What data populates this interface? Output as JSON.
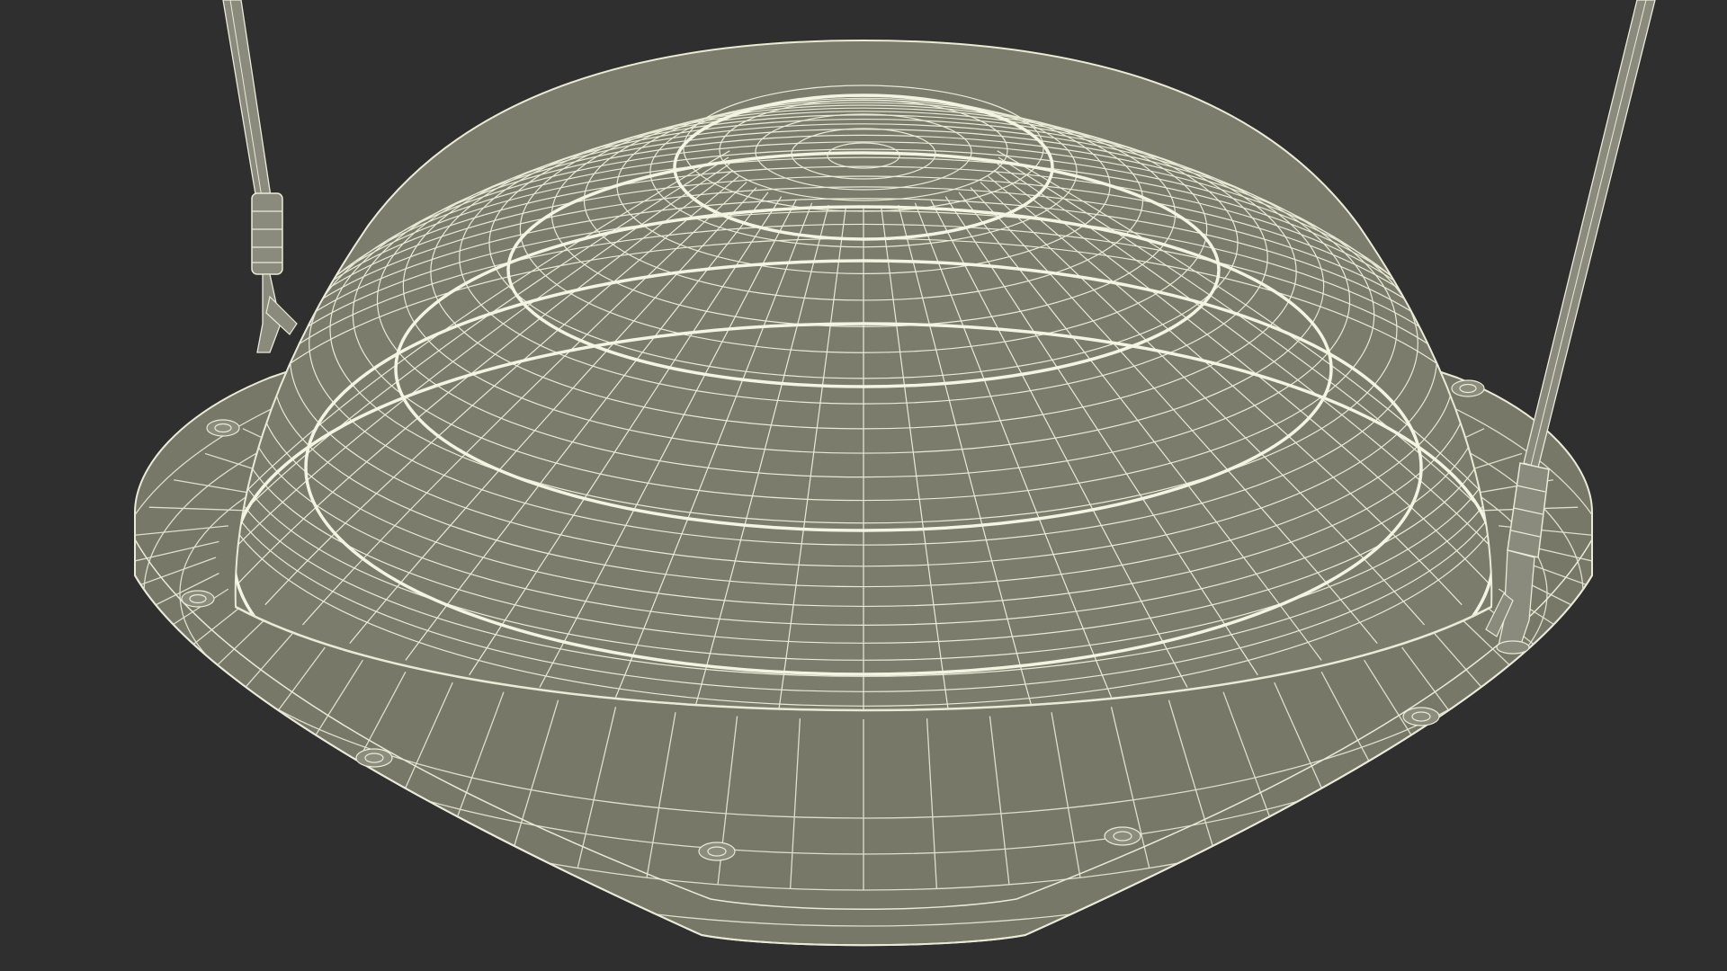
{
  "scene": {
    "subject_icon": "wireframe-dome-swing-icon",
    "colors": {
      "background": "#2f2f2f",
      "surface": "#7b7b6c",
      "surface_dark": "#666759",
      "wire": "#e9ebd6",
      "rope": "#8a8b7c"
    }
  }
}
